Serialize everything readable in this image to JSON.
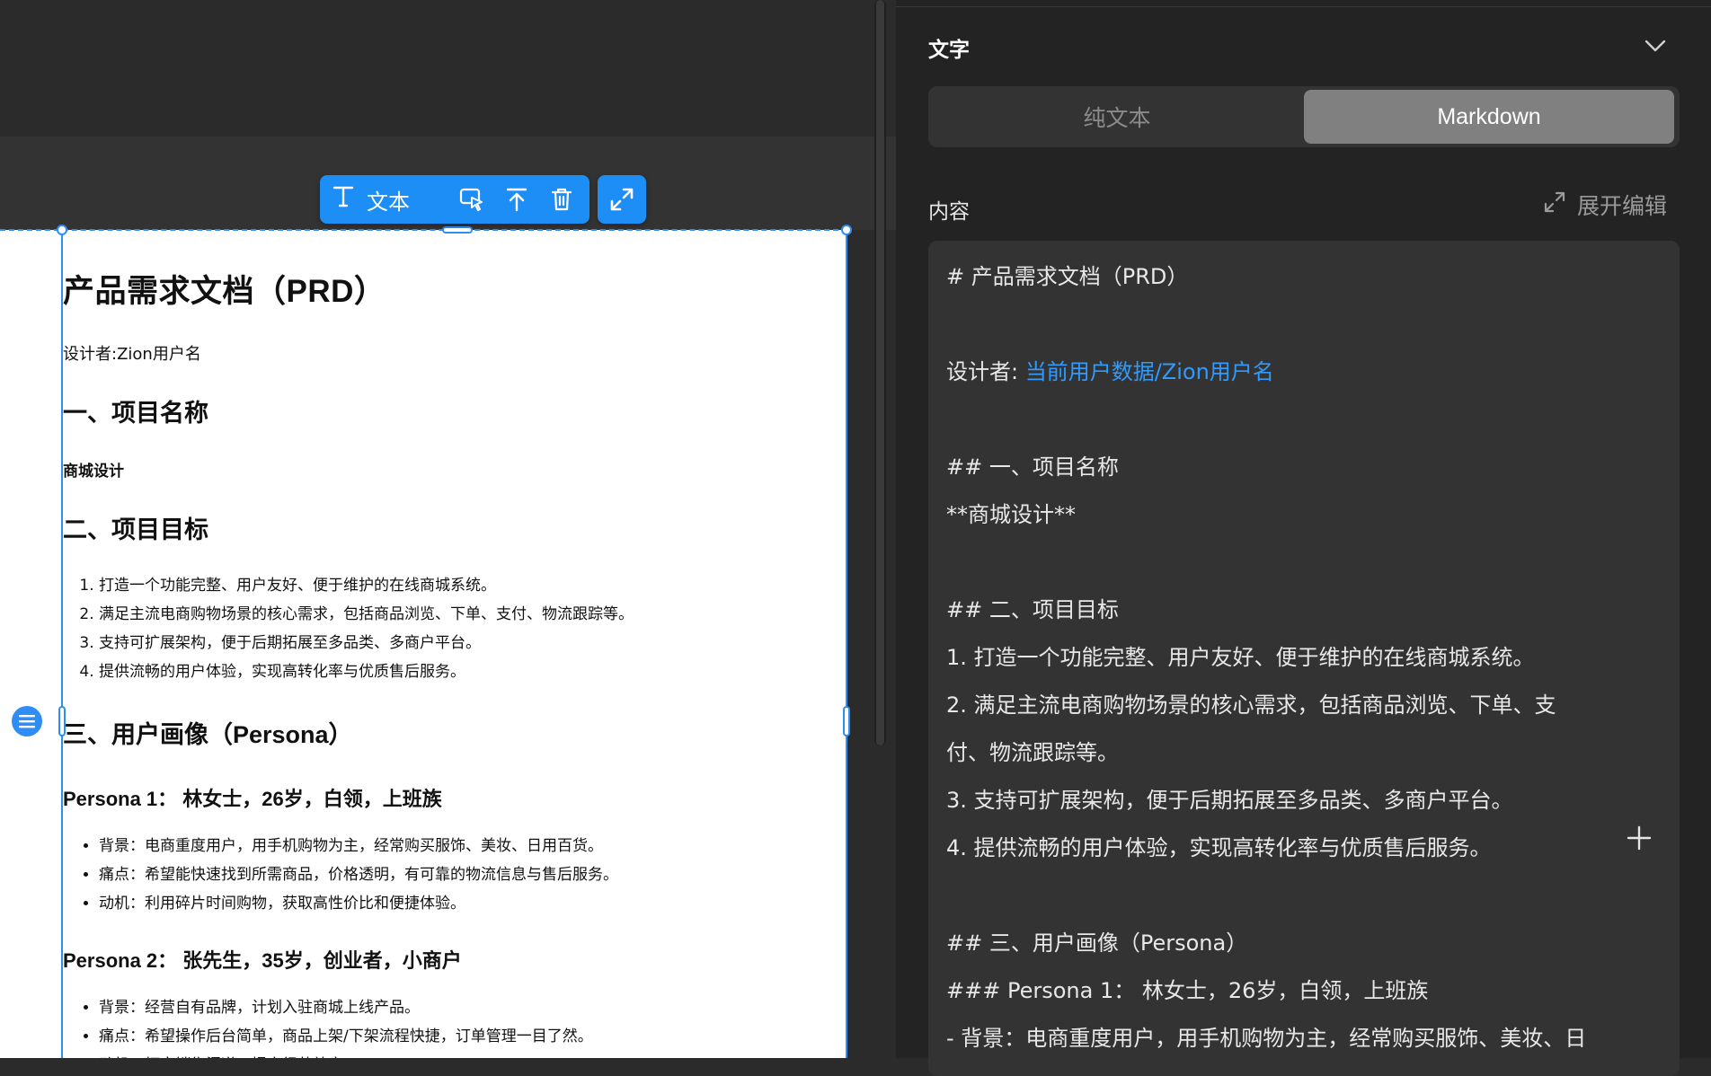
{
  "toolbar": {
    "type_label": "文本"
  },
  "document": {
    "title": "产品需求文档（PRD）",
    "designer": "设计者:Zion用户名",
    "section1_heading": "一、项目名称",
    "section1_body": "商城设计",
    "section2_heading": "二、项目目标",
    "goals": [
      "打造一个功能完整、用户友好、便于维护的在线商城系统。",
      "满足主流电商购物场景的核心需求，包括商品浏览、下单、支付、物流跟踪等。",
      "支持可扩展架构，便于后期拓展至多品类、多商户平台。",
      "提供流畅的用户体验，实现高转化率与优质售后服务。"
    ],
    "section3_heading": "三、用户画像（Persona）",
    "persona1_heading": "Persona 1： 林女士，26岁，白领，上班族",
    "persona1_items": [
      "背景：电商重度用户，用手机购物为主，经常购买服饰、美妆、日用百货。",
      "痛点：希望能快速找到所需商品，价格透明，有可靠的物流信息与售后服务。",
      "动机：利用碎片时间购物，获取高性价比和便捷体验。"
    ],
    "persona2_heading": "Persona 2： 张先生，35岁，创业者，小商户",
    "persona2_items": [
      "背景：经营自有品牌，计划入驻商城上线产品。",
      "痛点：希望操作后台简单，商品上架/下架流程快捷，订单管理一目了然。",
      "动机：拓宽销售渠道，提高经营效率。"
    ]
  },
  "panel": {
    "title": "文字",
    "mode_plain": "纯文本",
    "mode_markdown": "Markdown",
    "content_label": "内容",
    "expand_edit": "展开编辑",
    "editor": {
      "l1": "# 产品需求文档（PRD）",
      "l2_prefix": "设计者: ",
      "l2_link": "当前用户数据/Zion用户名",
      "l3": "## 一、项目名称",
      "l4": "**商城设计**",
      "l5": "## 二、项目目标",
      "l6": "1. 打造一个功能完整、用户友好、便于维护的在线商城系统。",
      "l7": "2. 满足主流电商购物场景的核心需求，包括商品浏览、下单、支",
      "l8": "付、物流跟踪等。",
      "l9": "3. 支持可扩展架构，便于后期拓展至多品类、多商户平台。",
      "l10": "4. 提供流畅的用户体验，实现高转化率与优质售后服务。",
      "l11": "## 三、用户画像（Persona）",
      "l12": "### Persona 1： 林女士，26岁，白领，上班族",
      "l13": "- 背景：电商重度用户，用手机购物为主，经常购买服饰、美妆、日"
    }
  },
  "colors": {
    "accent": "#1e8ef7",
    "link": "#2f9bff",
    "panel_bg": "#232323"
  },
  "icons": [
    "text-type-icon",
    "select-pointer-icon",
    "move-up-icon",
    "trash-icon",
    "expand-icon",
    "chevron-down-icon",
    "expand-edit-icon",
    "plus-icon",
    "list-icon"
  ]
}
